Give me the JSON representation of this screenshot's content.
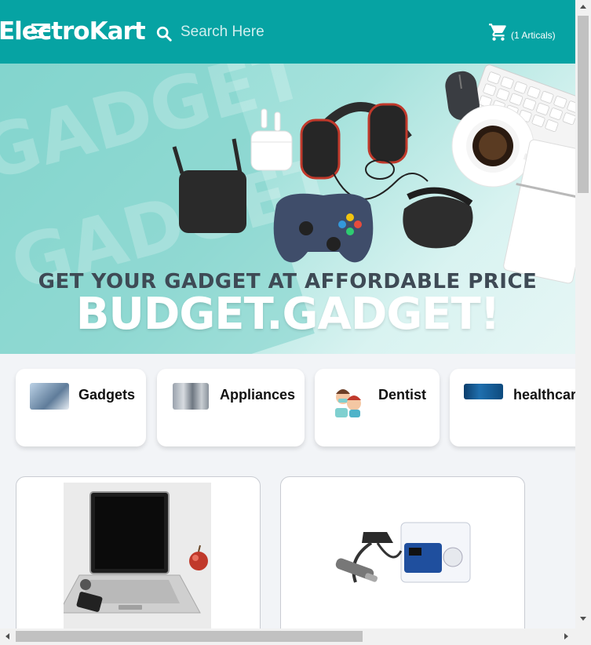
{
  "header": {
    "logo": "ElectroKart",
    "search_placeholder": "Search Here",
    "cart_count": "(1 Articals)",
    "bg_color": "#06a3a3"
  },
  "banner": {
    "tagline": "GET YOUR GADGET AT AFFORDABLE PRICE",
    "headline": "BUDGET.GADGET!",
    "watermark": "GADGET"
  },
  "categories": [
    {
      "label": "Gadgets",
      "icon": "gadgets-thumbnail"
    },
    {
      "label": "Appliances",
      "icon": "appliances-thumbnail"
    },
    {
      "label": "Dentist",
      "icon": "dentist-thumbnail"
    },
    {
      "label": "healthcare",
      "icon": "healthcare-thumbnail"
    }
  ],
  "products": [
    {
      "image": "laptop-image"
    },
    {
      "image": "dental-equipment-image"
    }
  ]
}
